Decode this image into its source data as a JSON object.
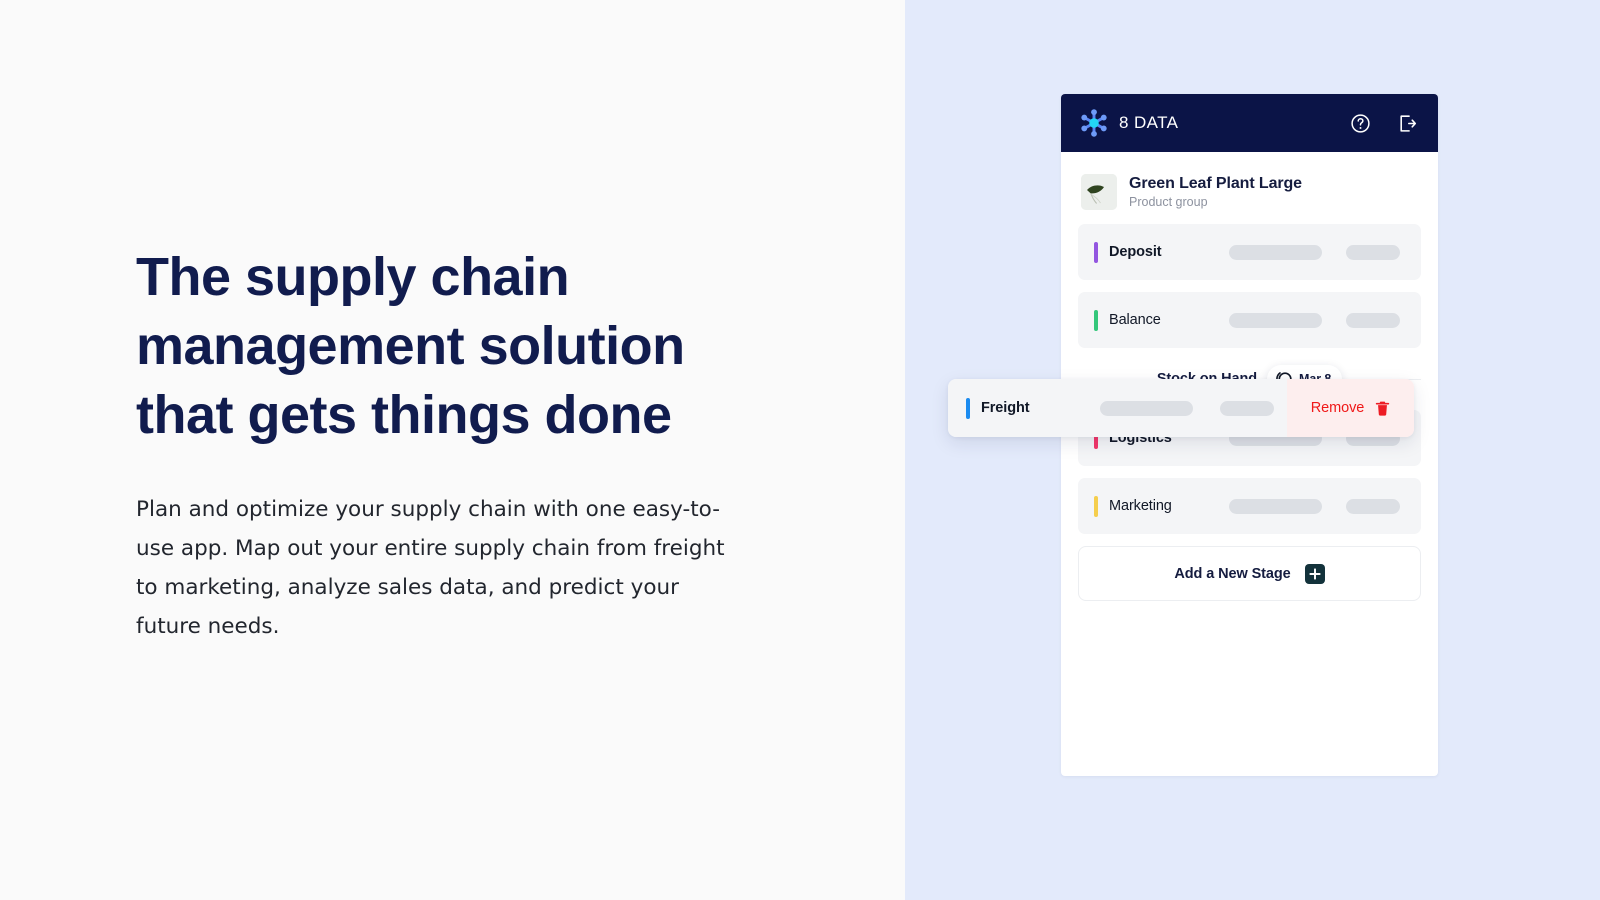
{
  "hero": {
    "title": "The supply chain management solution that gets things done",
    "body": "Plan and optimize your supply chain with one easy-to-use app. Map out your entire supply chain from freight to marketing, analyze sales data, and predict your future needs.",
    "title_color": "#111C4E",
    "body_color": "#22262E",
    "background": "#FAFAFA"
  },
  "right_panel": {
    "background": "#E3EAFB"
  },
  "app": {
    "header": {
      "brand_name": "8 DATA",
      "brand_logo_icon": "node-cluster-logo-icon",
      "help_icon": "question-circle-icon",
      "logout_icon": "logout-arrow-icon",
      "background": "#0B1447"
    },
    "product": {
      "title": "Green Leaf Plant Large",
      "subtitle": "Product group",
      "thumbnail_icon": "green-leaf-thumbnail"
    },
    "stages": [
      {
        "label": "Deposit",
        "color": "#9356E0",
        "bold": true,
        "has_wide_placeholder": true,
        "has_narrow_placeholder": true
      },
      {
        "label": "Balance",
        "color": "#34C77B",
        "bold": false,
        "has_wide_placeholder": true,
        "has_narrow_placeholder": true
      }
    ],
    "dragged_stage": {
      "label": "Freight",
      "color": "#1B8BF0",
      "bold": true,
      "remove_label": "Remove",
      "remove_icon": "trash-icon",
      "remove_color": "#F01818",
      "remove_background": "#FDEEEE"
    },
    "divider": {
      "label": "Stock on Hand",
      "date_badge": {
        "icon": "clock-circle-icon",
        "text": "Mar 8"
      }
    },
    "stages_lower": [
      {
        "label": "Logistics",
        "color": "#F4366A",
        "bold": true,
        "has_wide_placeholder": true,
        "has_narrow_placeholder": true
      },
      {
        "label": "Marketing",
        "color": "#F5CE4D",
        "bold": false,
        "has_wide_placeholder": true,
        "has_narrow_placeholder": true
      }
    ],
    "add_stage": {
      "label": "Add a New Stage",
      "icon": "plus-icon"
    }
  }
}
